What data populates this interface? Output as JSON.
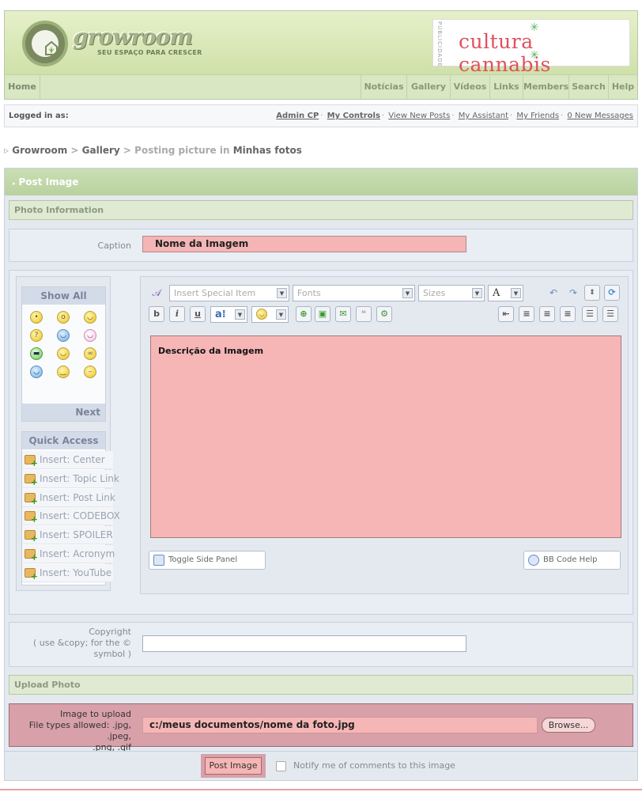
{
  "header": {
    "logo_text": "growroom",
    "logo_tagline": "SEU ESPAÇO PARA CRESCER",
    "ad_vertical": "PUBLICIDADE",
    "ad_text": "cultura cannabis"
  },
  "nav": {
    "home": "Home",
    "items": [
      "Notícias",
      "Gallery",
      "Vídeos",
      "Links",
      "Members",
      "Search",
      "Help"
    ]
  },
  "userbar": {
    "logged_in": "Logged in as:",
    "links": [
      "Admin CP",
      "My Controls",
      "View New Posts",
      "My Assistant",
      "My Friends",
      "0 New Messages"
    ]
  },
  "breadcrumb": {
    "root": "Growroom",
    "sep": ">",
    "gallery": "Gallery",
    "posting": "Posting picture in",
    "album": "Minhas fotos"
  },
  "post": {
    "title": "Post Image",
    "photo_info_header": "Photo Information",
    "caption_label": "Caption",
    "caption_value": "Nome da Imagem",
    "emoticons": {
      "show_all": "Show All",
      "next": "Next"
    },
    "quick_access": {
      "title": "Quick Access",
      "items": [
        "Insert: Center",
        "Insert: Topic Link",
        "Insert: Post Link",
        "Insert: CODEBOX",
        "Insert: SPOILER",
        "Insert: Acronym",
        "Insert: YouTube"
      ]
    },
    "toolbar": {
      "special_item": "Insert Special Item",
      "fonts": "Fonts",
      "sizes": "Sizes",
      "bold": "b",
      "italic": "i",
      "underline": "u",
      "font_color": "A"
    },
    "editor_text": "Descrição da Imagem",
    "toggle_side_panel": "Toggle Side Panel",
    "bb_code_help": "BB Code Help",
    "copyright_label_line1": "Copyright",
    "copyright_label_line2": "( use &copy; for the ©",
    "copyright_label_line3": "symbol )",
    "upload_header": "Upload Photo",
    "upload_label_line1": "Image to upload",
    "upload_label_line2": "File types allowed: .jpg, .jpeg,",
    "upload_label_line3": ".png, .gif",
    "file_value": "c:/meus documentos/nome da foto.jpg",
    "browse": "Browse...",
    "submit": "Post Image",
    "notify": "Notify me of comments to this image"
  }
}
